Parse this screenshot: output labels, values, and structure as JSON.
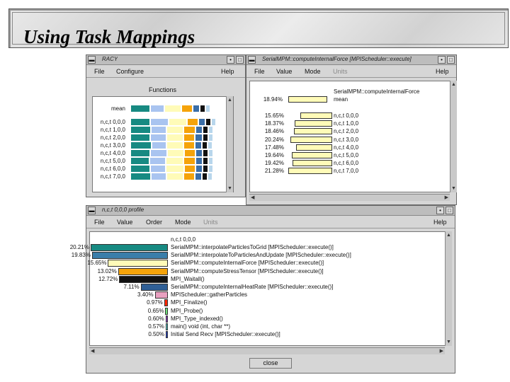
{
  "slide": {
    "title": "Using Task Mappings"
  },
  "racy": {
    "title": "RACY",
    "menu": [
      "File",
      "Configure",
      "Help"
    ],
    "functions_title": "Functions",
    "colors": [
      "#178a82",
      "#a9c4f0",
      "#fffbb8",
      "#f5a30a",
      "#3a6ea8",
      "#111111",
      "#b8d6ec"
    ],
    "rows": [
      {
        "label": "mean",
        "segs": [
          26,
          18,
          22,
          14,
          8,
          6,
          5
        ]
      },
      {
        "label": "n,c,t 0,0,0",
        "segs": [
          26,
          24,
          24,
          14,
          8,
          6,
          5
        ]
      },
      {
        "label": "n,c,t 1,0,0",
        "segs": [
          27,
          20,
          22,
          15,
          8,
          6,
          5
        ]
      },
      {
        "label": "n,c,t 2,0,0",
        "segs": [
          26,
          21,
          22,
          14,
          9,
          6,
          5
        ]
      },
      {
        "label": "n,c,t 3,0,0",
        "segs": [
          28,
          19,
          22,
          14,
          8,
          6,
          5
        ]
      },
      {
        "label": "n,c,t 4,0,0",
        "segs": [
          26,
          22,
          22,
          14,
          8,
          6,
          5
        ]
      },
      {
        "label": "n,c,t 5,0,0",
        "segs": [
          25,
          21,
          23,
          15,
          8,
          6,
          5
        ]
      },
      {
        "label": "n,c,t 6,0,0",
        "segs": [
          26,
          20,
          24,
          14,
          8,
          6,
          5
        ]
      },
      {
        "label": "n,c,t 7,0,0",
        "segs": [
          27,
          20,
          22,
          14,
          8,
          6,
          5
        ]
      }
    ]
  },
  "func": {
    "title": "SerialMPM::computeInternalForce [MPIScheduler::execute]",
    "menu": [
      "File",
      "Value",
      "Mode",
      "Units",
      "Help"
    ],
    "header_name": "SerialMPM::computeInternalForce",
    "mean_pct": "18.94%",
    "mean_value": 18.94,
    "mean_label": "mean",
    "rows": [
      {
        "pct": "15.65%",
        "value": 15.65,
        "label": "n,c,t 0,0,0"
      },
      {
        "pct": "18.37%",
        "value": 18.37,
        "label": "n,c,t 1,0,0"
      },
      {
        "pct": "18.46%",
        "value": 18.46,
        "label": "n,c,t 2,0,0"
      },
      {
        "pct": "20.24%",
        "value": 20.24,
        "label": "n,c,t 3,0,0"
      },
      {
        "pct": "17.48%",
        "value": 17.48,
        "label": "n,c,t 4,0,0"
      },
      {
        "pct": "19.64%",
        "value": 19.64,
        "label": "n,c,t 5,0,0"
      },
      {
        "pct": "19.42%",
        "value": 19.42,
        "label": "n,c,t 6,0,0"
      },
      {
        "pct": "21.28%",
        "value": 21.28,
        "label": "n,c,t 7,0,0"
      }
    ]
  },
  "profile": {
    "title": "n,c,t 0,0,0 profile",
    "menu": [
      "File",
      "Value",
      "Order",
      "Mode",
      "Units",
      "Help"
    ],
    "header": "n,c,t 0,0,0",
    "rows": [
      {
        "pct": "20.21%",
        "value": 20.21,
        "color": "#178a82",
        "label": "SerialMPM::interpolateParticlesToGrid [MPIScheduler::execute()]"
      },
      {
        "pct": "19.83%",
        "value": 19.83,
        "color": "#3a7eaa",
        "label": "SerialMPM::interpolateToParticlesAndUpdate [MPIScheduler::execute()]"
      },
      {
        "pct": "15.65%",
        "value": 15.65,
        "color": "#fffbb8",
        "label": "SerialMPM::computeInternalForce [MPIScheduler::execute()]"
      },
      {
        "pct": "13.02%",
        "value": 13.02,
        "color": "#f5a30a",
        "label": "SerialMPM::computeStressTensor [MPIScheduler::execute()]"
      },
      {
        "pct": "12.72%",
        "value": 12.72,
        "color": "#111111",
        "label": "MPI_Waitall()"
      },
      {
        "pct": "7.11%",
        "value": 7.11,
        "color": "#2f5f96",
        "label": "SerialMPM::computeInternalHeatRate [MPIScheduler::execute()]"
      },
      {
        "pct": "3.40%",
        "value": 3.4,
        "color": "#e9a0c0",
        "label": "MPIScheduler::gatherParticles"
      },
      {
        "pct": "0.97%",
        "value": 0.97,
        "color": "#ff2a00",
        "label": "MPI_Finalize()"
      },
      {
        "pct": "0.65%",
        "value": 0.65,
        "color": "#6fe07a",
        "label": "MPI_Probe()"
      },
      {
        "pct": "0.60%",
        "value": 0.6,
        "color": "#9a3ad0",
        "label": "MPI_Type_indexed()"
      },
      {
        "pct": "0.57%",
        "value": 0.57,
        "color": "#5ad0d0",
        "label": "main() void (int, char **)"
      },
      {
        "pct": "0.50%",
        "value": 0.5,
        "color": "#2040d0",
        "label": "Initial Send Recv [MPIScheduler::execute()]"
      }
    ],
    "close_label": "close"
  }
}
